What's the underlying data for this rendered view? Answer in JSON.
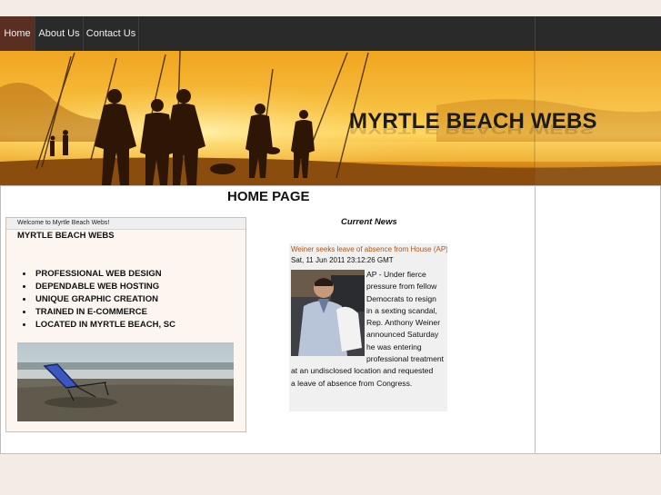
{
  "nav": {
    "items": [
      {
        "label": "Home",
        "active": true
      },
      {
        "label": "About Us",
        "active": false
      },
      {
        "label": "Contact Us",
        "active": false
      }
    ]
  },
  "banner": {
    "title": "MYRTLE BEACH WEBS"
  },
  "main": {
    "heading": "HOME PAGE"
  },
  "welcome": {
    "header": "Welcome to Myrtle Beach Webs!",
    "title": "MYRTLE BEACH WEBS",
    "services": [
      "PROFESSIONAL WEB DESIGN",
      "DEPENDABLE WEB HOSTING",
      "UNIQUE GRAPHIC CREATION",
      "TRAINED IN E-COMMERCE",
      "LOCATED IN MYRTLE BEACH, SC"
    ]
  },
  "news": {
    "heading": "Current News",
    "headline": "Weiner seeks leave of absence from House (AP)",
    "date": "Sat, 11 Jun 2011 23:12:26 GMT",
    "body_lines": [
      "AP - Under fierce",
      "pressure from fellow",
      "Democrats to resign",
      "in a sexting scandal,",
      "Rep. Anthony Weiner",
      "announced Saturday",
      "he was entering",
      "professional treatment",
      "at an undisclosed location and requested",
      "a leave of absence from Congress."
    ]
  },
  "colors": {
    "nav_bg": "#2a2a2a",
    "nav_active": "#5a2f22",
    "link": "#b0541c",
    "banner_gold": "#e8a020"
  }
}
